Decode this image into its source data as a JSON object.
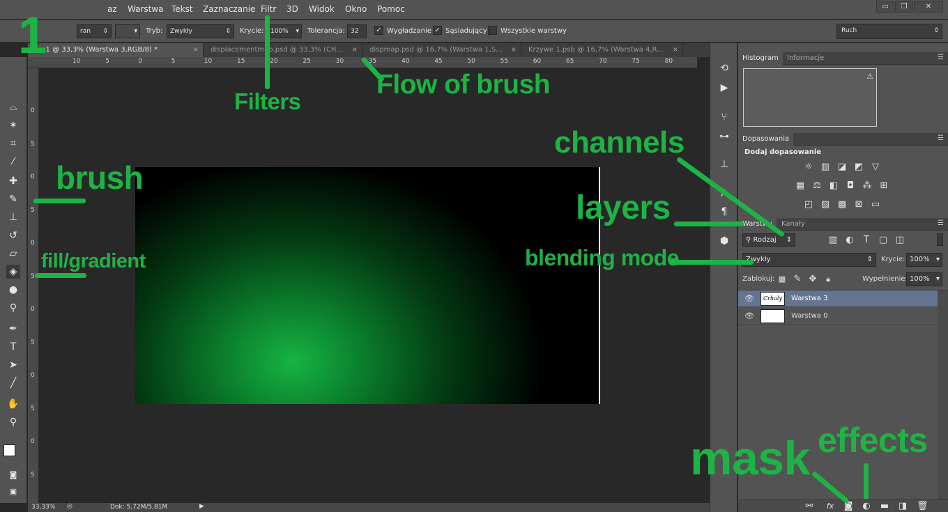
{
  "menu": {
    "items": [
      "az",
      "Warstwa",
      "Tekst",
      "Zaznaczanie",
      "Filtr",
      "3D",
      "Widok",
      "Okno",
      "Pomoc"
    ]
  },
  "window_buttons": {
    "minimize": "▭",
    "restore": "❐",
    "close": "✕"
  },
  "options": {
    "style_value": "ran",
    "mode_label": "Tryb:",
    "mode_value": "Zwykły",
    "opacity_label": "Krycie:",
    "opacity_value": "100%",
    "tolerance_label": "Tolerancja:",
    "tolerance_value": "32",
    "smoothing_label": "Wygładzanie",
    "contiguous_label": "Sąsiadujący",
    "all_layers_label": "Wszystkie warstwy",
    "workspace_value": "Ruch"
  },
  "tabs": [
    {
      "label": "wy-1 @ 33,3% (Warstwa 3,RGB/8) *"
    },
    {
      "label": "displacementmap.psd @ 33,3% (CH..."
    },
    {
      "label": "dispmap.psd @ 16,7% (Warstwa 1,S..."
    },
    {
      "label": "Krzywe 1.psb @ 16,7% (Warstwa 4,R..."
    }
  ],
  "ruler": {
    "h_ticks": [
      "10",
      "5",
      "0",
      "5",
      "10",
      "15",
      "20",
      "25",
      "30",
      "35",
      "40",
      "45",
      "50",
      "55",
      "60",
      "65",
      "70",
      "75",
      "80"
    ],
    "v_ticks": [
      "0",
      "5",
      "0",
      "5",
      "0",
      "5",
      "0",
      "5",
      "0",
      "5",
      "0",
      "5",
      "0"
    ]
  },
  "status": {
    "zoom": "33,33%",
    "doc": "Dok: 5,72M/5,81M"
  },
  "panels": {
    "histogram": {
      "tab1": "Histogram",
      "tab2": "Informacje",
      "warning": "⚠"
    },
    "adjustments": {
      "tab": "Dopasowania",
      "title": "Dodaj dopasowanie"
    },
    "layers": {
      "tab1": "Warstwy",
      "tab2": "Kanały",
      "filter_value": "Rodzaj",
      "blend_value": "Zwykły",
      "opacity_label": "Krycie:",
      "opacity_value": "100%",
      "lock_label": "Zablokuj:",
      "fill_label": "Wypełnienie:",
      "fill_value": "100%",
      "rows": [
        {
          "name": "Warstwa 3",
          "thumb_text": "Crhaly"
        },
        {
          "name": "Warstwa 0",
          "thumb_text": ""
        }
      ]
    }
  },
  "annotations": {
    "step_number": "1",
    "filters": "Filters",
    "flow": "Flow of brush",
    "channels": "channels",
    "brush": "brush",
    "layers": "layers",
    "blending": "blending mode",
    "fill": "fill/gradient",
    "mask": "mask",
    "effects": "effects"
  },
  "colors": {
    "annotation": "#1db345",
    "panel": "#535353",
    "canvas_bg": "#282828",
    "selected_layer": "#637591"
  }
}
